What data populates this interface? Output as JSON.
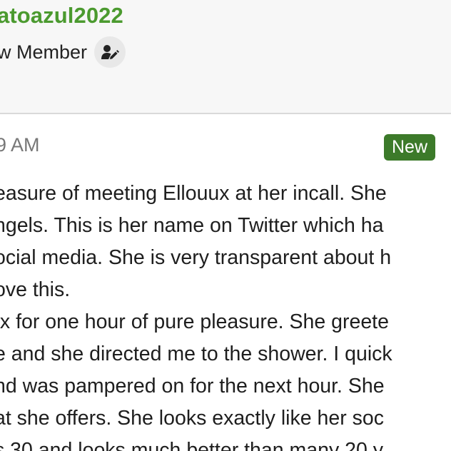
{
  "author": {
    "username": "atoazul2022",
    "role": "w Member",
    "role_icon": "user-edit-icon"
  },
  "post": {
    "timestamp": "9 AM",
    "badge": "New",
    "lines": [
      "easure of meeting Ellouux at her incall. She",
      "ngels. This is her name on Twitter which ha",
      "ocial media. She is very transparent about h",
      "ove this.",
      "ıx for one hour of pure pleasure. She greete",
      "e and she directed me to the shower. I quick",
      "nd was pampered on for the next hour. She",
      "at she offers. She looks exactly like her soc",
      "s 30 and looks much better than many 20 y"
    ]
  },
  "colors": {
    "username": "#4b9a2f",
    "badge": "#3c7a2a",
    "header_bg": "#f7f7f7",
    "post_bg": "#ffffff"
  }
}
